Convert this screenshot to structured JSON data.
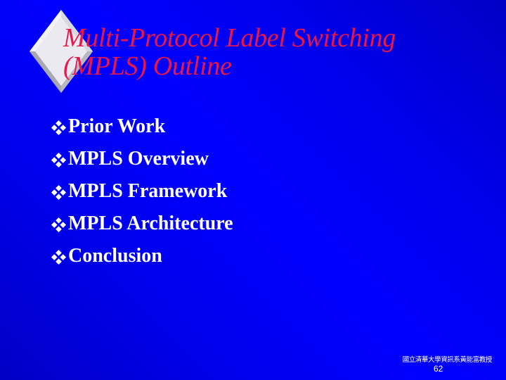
{
  "slide": {
    "title_lines": [
      "Multi-Protocol Label Switching",
      "(MPLS) Outline"
    ],
    "bullet_icon": "four-diamond-bullet-icon",
    "bullets": [
      {
        "label": "Prior Work"
      },
      {
        "label": "MPLS Overview"
      },
      {
        "label": "MPLS Framework"
      },
      {
        "label": "MPLS Architecture"
      },
      {
        "label": "Conclusion"
      }
    ],
    "footer": {
      "organization": "國立清華大學資訊系黃能富教授",
      "page_number": "62"
    }
  },
  "colors": {
    "background": "#0000FF",
    "background_dark": "#0000C0",
    "title": "#E8174B",
    "bullet_text": "#FFFFFF",
    "diamond_face": "#E8E8EE",
    "diamond_edge": "#B4B4BC"
  }
}
